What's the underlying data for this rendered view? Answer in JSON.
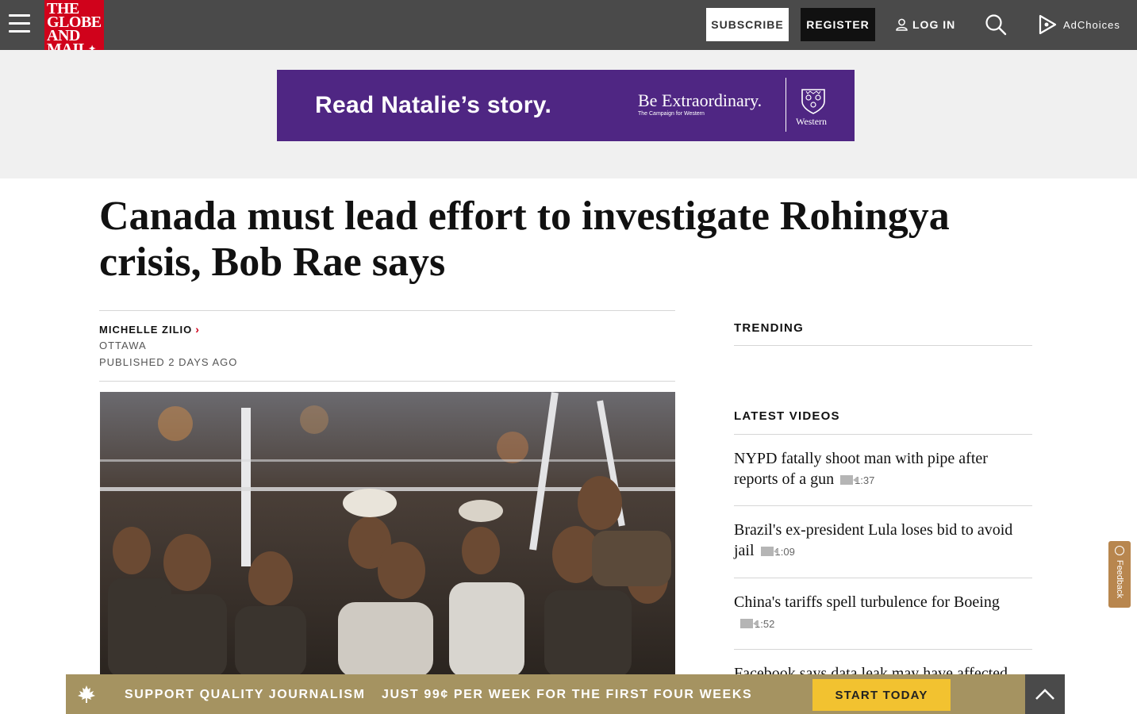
{
  "header": {
    "logo_lines": [
      "THE",
      "GLOBE",
      "AND",
      "MAIL"
    ],
    "subscribe_label": "SUBSCRIBE",
    "register_label": "REGISTER",
    "login_label": "LOG IN",
    "adchoices_label": "AdChoices"
  },
  "ad": {
    "headline": "Read Natalie’s story.",
    "tagline": "Be Extraordinary.",
    "campaign": "The Campaign for Western",
    "brand": "Western",
    "background": "#4f2683"
  },
  "article": {
    "headline": "Canada must lead effort to investigate Rohingya crisis, Bob Rae says",
    "author": "MICHELLE ZILIO",
    "location": "OTTAWA",
    "published": "PUBLISHED 2 DAYS AGO"
  },
  "sidebar": {
    "trending_heading": "TRENDING",
    "videos_heading": "LATEST VIDEOS",
    "videos": [
      {
        "title": "NYPD fatally shoot man with pipe after reports of a gun",
        "duration": "1:37"
      },
      {
        "title": "Brazil's ex-president Lula loses bid to avoid jail",
        "duration": "1:09"
      },
      {
        "title": "China's tariffs spell turbulence for Boeing",
        "duration": "1:52"
      },
      {
        "title": "Facebook says data leak may have affected",
        "duration": ""
      }
    ]
  },
  "feedback": {
    "label": "Feedback"
  },
  "promo": {
    "support_text": "SUPPORT QUALITY JOURNALISM",
    "price_text": "JUST 99¢ PER WEEK FOR THE FIRST FOUR WEEKS",
    "cta_label": "START TODAY",
    "bar_color": "#a59361",
    "cta_color": "#f2c230"
  },
  "colors": {
    "brand_red": "#d0021b",
    "topbar": "#4a4a4a"
  },
  "icons": [
    "menu-icon",
    "user-icon",
    "search-icon",
    "adchoices-icon",
    "maple-leaf-icon",
    "chevron-up-icon",
    "video-camera-icon"
  ]
}
